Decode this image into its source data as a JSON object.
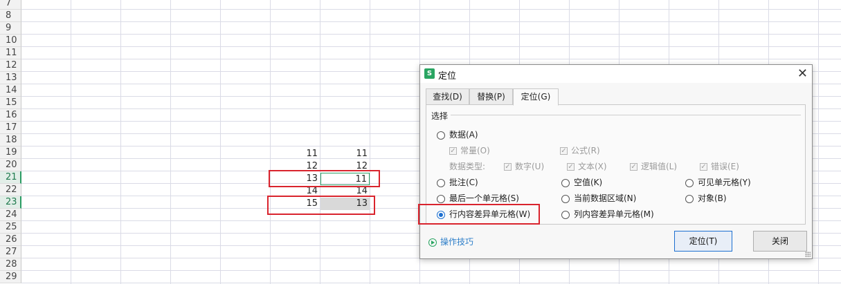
{
  "sheet": {
    "row_numbers": [
      "7",
      "8",
      "9",
      "10",
      "11",
      "12",
      "13",
      "14",
      "15",
      "16",
      "17",
      "18",
      "19",
      "20",
      "21",
      "22",
      "23",
      "24",
      "25",
      "26",
      "27",
      "28",
      "29"
    ],
    "selected_rows": [
      "21",
      "23"
    ],
    "cells": [
      {
        "row": "19",
        "a": "11",
        "b": "11"
      },
      {
        "row": "20",
        "a": "12",
        "b": "12"
      },
      {
        "row": "21",
        "a": "13",
        "b": "11"
      },
      {
        "row": "22",
        "a": "14",
        "b": "14"
      },
      {
        "row": "23",
        "a": "15",
        "b": "13"
      }
    ]
  },
  "dialog": {
    "title": "定位",
    "app_icon": "S",
    "close_glyph": "✕",
    "tabs": [
      {
        "label": "查找(D)",
        "active": false
      },
      {
        "label": "替换(P)",
        "active": false
      },
      {
        "label": "定位(G)",
        "active": true
      }
    ],
    "group_label": "选择",
    "options": {
      "data": "数据(A)",
      "constant": "常量(O)",
      "formula": "公式(R)",
      "data_type_label": "数据类型:",
      "number": "数字(U)",
      "text": "文本(X)",
      "logical": "逻辑值(L)",
      "error": "错误(E)",
      "comment": "批注(C)",
      "blank": "空值(K)",
      "visible_cells": "可见单元格(Y)",
      "last_cell": "最后一个单元格(S)",
      "current_region": "当前数据区域(N)",
      "objects": "对象(B)",
      "row_differences": "行内容差异单元格(W)",
      "column_differences": "列内容差异单元格(M)"
    },
    "selected_option": "row_differences",
    "tips_link": "操作技巧",
    "ok_button": "定位(T)",
    "close_button": "关闭"
  },
  "colors": {
    "highlight_box": "#d9232d",
    "accent_green": "#2aa562",
    "radio_selected": "#1c6fd0",
    "link": "#2e7fc9"
  }
}
